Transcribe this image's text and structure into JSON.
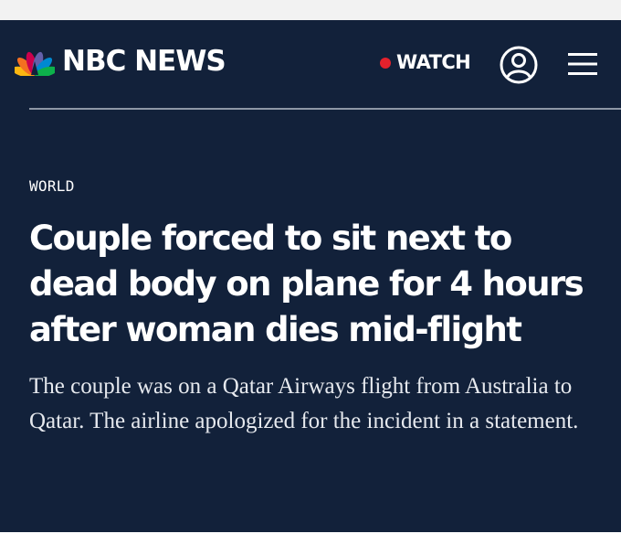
{
  "header": {
    "brand": "NBC NEWS",
    "watch_label": "WATCH",
    "icons": {
      "logo": "nbc-peacock-icon",
      "account": "user-account-icon",
      "menu": "hamburger-menu-icon"
    }
  },
  "article": {
    "section": "WORLD",
    "headline": "Couple forced to sit next to dead body on plane for 4 hours after woman dies mid-flight",
    "dek": "The couple was on a Qatar Airways flight from Australia to Qatar. The airline apologized for the incident in a statement."
  },
  "colors": {
    "panel_background": "#12213a",
    "live_dot": "#e4212c",
    "text": "#ffffff"
  }
}
